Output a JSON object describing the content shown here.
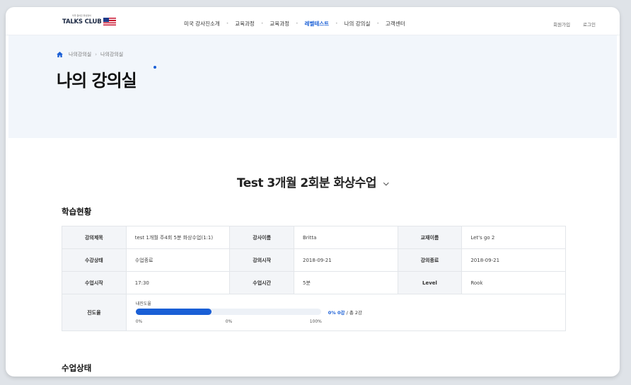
{
  "header": {
    "logo_tagline": "미국 원어민 화상영어",
    "logo_text": "TALKS CLUB",
    "nav": [
      {
        "label": "미국 강사진소개",
        "active": false
      },
      {
        "label": "교육과정",
        "active": false
      },
      {
        "label": "교육과정",
        "active": false
      },
      {
        "label": "레벨테스트",
        "active": true
      },
      {
        "label": "나의 강의실",
        "active": false
      },
      {
        "label": "고객센터",
        "active": false
      }
    ],
    "nav_separator": "•",
    "signup_label": "회원가입",
    "login_label": "로그인"
  },
  "hero": {
    "breadcrumb": [
      "나의강의실",
      "나의강의실"
    ],
    "breadcrumb_separator": "›",
    "title": "나의 강의실"
  },
  "course_select": {
    "value": "Test 3개월 2회분 화상수업",
    "icon": "chevron-down-icon"
  },
  "study_status": {
    "section_title": "학습현황",
    "rows": [
      [
        {
          "label": "강의제목",
          "value": "test 1개월 주4회 5분 화상수업(1:1)"
        },
        {
          "label": "강사이름",
          "value": "Britta"
        },
        {
          "label": "교재이름",
          "value": "Let's go 2"
        }
      ],
      [
        {
          "label": "수강상태",
          "value": "수업종료"
        },
        {
          "label": "강의시작",
          "value": "2018-09-21"
        },
        {
          "label": "강의종료",
          "value": "2018-09-21"
        }
      ],
      [
        {
          "label": "수업시작",
          "value": "17:30"
        },
        {
          "label": "수업시간",
          "value": "5분"
        },
        {
          "label": "Level",
          "value": "Rook"
        }
      ]
    ],
    "progress": {
      "label": "진도율",
      "sub_label": "내진도율",
      "fill_fraction": 0.41,
      "percent_text": "0% 0강",
      "total_text": "/ 총 2강",
      "ticks": [
        "0%",
        "0%",
        "100%"
      ]
    }
  },
  "class_status": {
    "section_title": "수업상태"
  },
  "colors": {
    "accent": "#1a5fd6",
    "hero_bg": "#f2f6fb",
    "table_header_bg": "#f3f5f8"
  }
}
